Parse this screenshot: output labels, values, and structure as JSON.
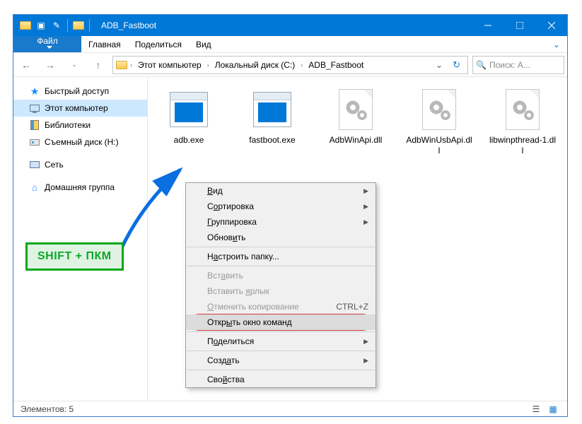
{
  "window": {
    "title": "ADB_Fastboot"
  },
  "menu": {
    "file": "Файл",
    "items": [
      "Главная",
      "Поделиться",
      "Вид"
    ]
  },
  "breadcrumb": {
    "root": "Этот компьютер",
    "drive": "Локальный диск (C:)",
    "folder": "ADB_Fastboot"
  },
  "search": {
    "placeholder": "Поиск: A..."
  },
  "sidebar": {
    "items": [
      {
        "label": "Быстрый доступ",
        "icon": "star"
      },
      {
        "label": "Этот компьютер",
        "icon": "pc",
        "selected": true
      },
      {
        "label": "Библиотеки",
        "icon": "lib"
      },
      {
        "label": "Съемный диск (H:)",
        "icon": "disk"
      },
      {
        "label": "Сеть",
        "icon": "net"
      },
      {
        "label": "Домашняя группа",
        "icon": "group"
      }
    ]
  },
  "files": [
    {
      "name": "adb.exe",
      "type": "exe"
    },
    {
      "name": "fastboot.exe",
      "type": "exe"
    },
    {
      "name": "AdbWinApi.dll",
      "type": "dll"
    },
    {
      "name": "AdbWinUsbApi.dll",
      "type": "dll"
    },
    {
      "name": "libwinpthread-1.dll",
      "type": "dll"
    }
  ],
  "context_menu": {
    "view": "Вид",
    "sort": "Сортировка",
    "group": "Группировка",
    "refresh": "Обновить",
    "customize": "Настроить папку...",
    "paste": "Вставить",
    "paste_shortcut": "Вставить ярлык",
    "undo": "Отменить копирование",
    "undo_key": "CTRL+Z",
    "open_cmd": "Открыть окно команд",
    "share": "Поделиться",
    "new": "Создать",
    "properties": "Свойства"
  },
  "status": {
    "count_label": "Элементов:",
    "count": "5"
  },
  "callout": {
    "text": "SHIFT + ПКМ"
  }
}
